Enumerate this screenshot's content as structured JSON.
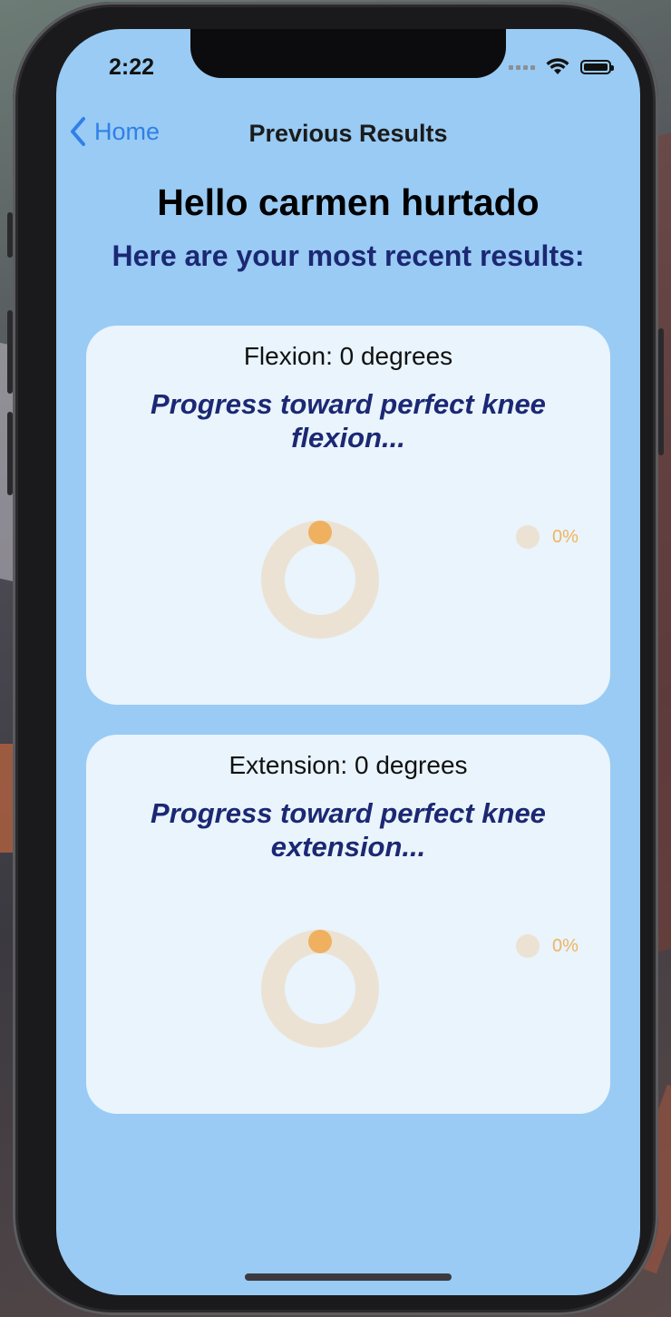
{
  "status_bar": {
    "time": "2:22"
  },
  "nav": {
    "back_label": "Home",
    "title": "Previous Results"
  },
  "greeting": "Hello carmen hurtado",
  "subheading": "Here are your most recent results:",
  "cards": [
    {
      "value_text": "Flexion: 0 degrees",
      "progress_text": "Progress toward perfect knee flexion...",
      "percent_label": "0%",
      "progress_fraction": 0
    },
    {
      "value_text": "Extension: 0 degrees",
      "progress_text": "Progress toward perfect knee extension...",
      "percent_label": "0%",
      "progress_fraction": 0
    }
  ],
  "colors": {
    "screen_bg": "#99cbf4",
    "card_bg": "#e9f4fc",
    "ring_track": "#ece2d3",
    "ring_progress": "#efb15f",
    "heading_navy": "#1c2873",
    "link_blue": "#2f80e8"
  },
  "icons": [
    "chevron-left-icon",
    "cellular-signal-icon",
    "wifi-icon",
    "battery-icon"
  ]
}
